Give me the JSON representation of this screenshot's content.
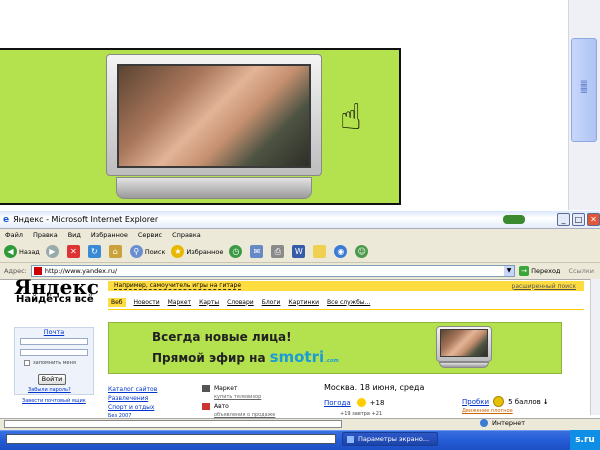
{
  "window": {
    "title": "Яндекс - Microsoft Internet Explorer"
  },
  "menu": [
    "Файл",
    "Правка",
    "Вид",
    "Избранное",
    "Сервис",
    "Справка"
  ],
  "toolbar": {
    "back": "Назад",
    "search": "Поиск",
    "favorites": "Избранное"
  },
  "address": {
    "label": "Адрес:",
    "url": "http://www.yandex.ru/",
    "go": "Переход",
    "links": "Ссылки"
  },
  "page": {
    "logo": "Яндекс",
    "slogan": "Найдётся всё",
    "example": "Например, самоучитель игры на гитаре",
    "advanced": "расширенный поиск",
    "tabs": [
      "Веб",
      "Новости",
      "Маркет",
      "Карты",
      "Словари",
      "Блоги",
      "Картинки",
      "Все службы..."
    ],
    "mail": {
      "title": "Почта",
      "remember": "запомнить меня",
      "login": "Войти",
      "forgot": "Забыли пароль?",
      "create": "Завести почтовый ящик"
    },
    "ad": {
      "line1": "Всегда новые лица!",
      "line2": "Прямой эфир на",
      "brand": "smotri",
      "com": ".com"
    },
    "catalog": [
      "Каталог сайтов",
      "Развлечения",
      "Спорт и отдых",
      "Без 2007"
    ],
    "services": [
      {
        "name": "Маркет",
        "sub": "купить телевизор"
      },
      {
        "name": "Авто",
        "sub": "объявления о продаже"
      }
    ],
    "city": "Москва. 18 июня, среда",
    "weather": {
      "label": "Погода",
      "temp": "+18",
      "extra": "+19   завтра +21"
    },
    "traffic": {
      "label": "Пробки",
      "score": "5 баллов",
      "arrow": "↓",
      "sub": "Движение плотное"
    }
  },
  "status": {
    "zone": "Интернет"
  },
  "taskbar": {
    "item": "Параметры экрано...",
    "tray": "s.ru"
  },
  "colors": {
    "banner_green": "#b4e24e",
    "yandex_yellow": "#ffdc40",
    "smotri_blue": "#1a9cd8"
  }
}
